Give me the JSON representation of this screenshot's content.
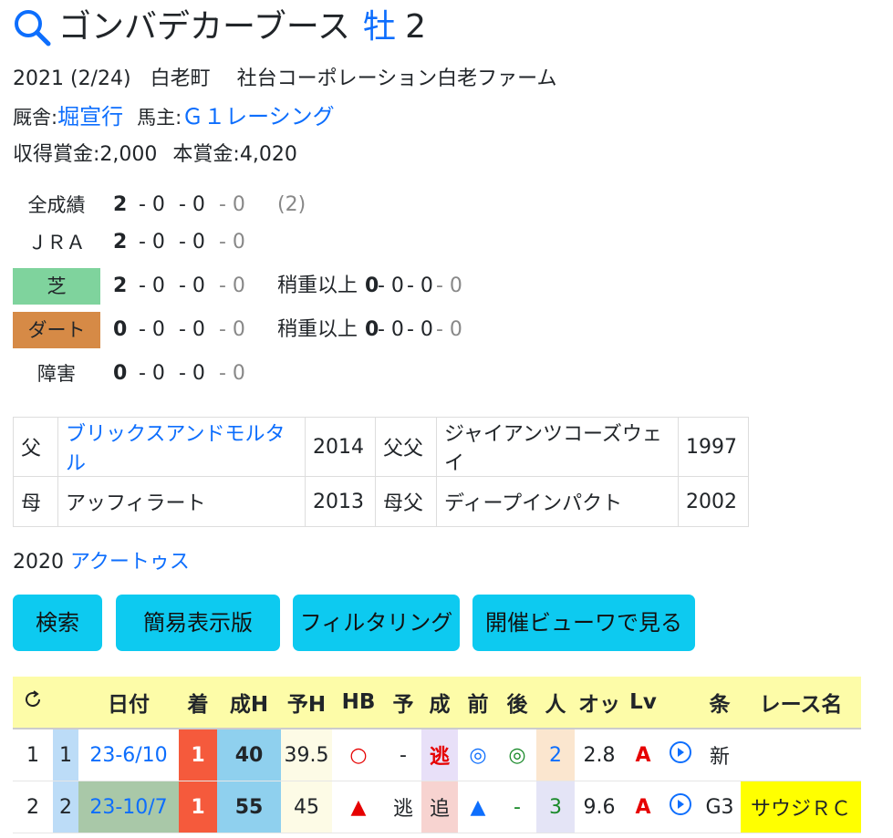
{
  "horse": {
    "name": "ゴンバデカーブース",
    "sex": "牡",
    "age": "2"
  },
  "birth": {
    "date": "2021 (2/24)",
    "place": "白老町",
    "breeder": "社台コーポレーション白老ファーム"
  },
  "stable": {
    "label": "厩舎:",
    "trainer": "堀宣行",
    "owner_label": "馬主:",
    "owner": "Ｇ１レーシング"
  },
  "prize": {
    "earned_label": "収得賞金:",
    "earned": "2,000",
    "main_label": "本賞金:",
    "main": "4,020"
  },
  "records": [
    {
      "label": "全成績",
      "n1": "2",
      "n2": "- 0",
      "n3": "- 0",
      "n4": "- 0",
      "extra": "(2)"
    },
    {
      "label": "ＪＲＡ",
      "n1": "2",
      "n2": "- 0",
      "n3": "- 0",
      "n4": "- 0",
      "extra": ""
    },
    {
      "label": "芝",
      "n1": "2",
      "n2": "- 0",
      "n3": "- 0",
      "n4": "- 0",
      "heavy_label": "稍重以上",
      "h1": "0",
      "h2": "- 0",
      "h3": "- 0",
      "h4": "- 0"
    },
    {
      "label": "ダート",
      "n1": "0",
      "n2": "- 0",
      "n3": "- 0",
      "n4": "- 0",
      "heavy_label": "稍重以上",
      "h1": "0",
      "h2": "- 0",
      "h3": "- 0",
      "h4": "- 0"
    },
    {
      "label": "障害",
      "n1": "0",
      "n2": "- 0",
      "n3": "- 0",
      "n4": "- 0"
    }
  ],
  "pedigree": [
    {
      "rel": "父",
      "name": "ブリックスアンドモルタル",
      "year": "2014",
      "rel2": "父父",
      "name2": "ジャイアンツコーズウェイ",
      "year2": "1997"
    },
    {
      "rel": "母",
      "name": "アッフィラート",
      "year": "2013",
      "rel2": "母父",
      "name2": "ディープインパクト",
      "year2": "2002"
    }
  ],
  "sibling": {
    "year": "2020",
    "name": "アクートゥス"
  },
  "buttons": [
    "検索",
    "簡易表示版",
    "フィルタリング",
    "開催ビューワで見る"
  ],
  "race_table": {
    "headers": [
      "",
      "",
      "日付",
      "着",
      "成H",
      "予H",
      "HB",
      "予",
      "成",
      "前",
      "後",
      "人",
      "オッ",
      "Lv",
      "",
      "条",
      "レース名"
    ],
    "rows": [
      {
        "no": "1",
        "n": "1",
        "date": "23-6/10",
        "place": "1",
        "seiH": "40",
        "yoH": "39.5",
        "hb": "○",
        "yo": "-",
        "sei": "逃",
        "mae": "◎",
        "ato": "◎",
        "pop": "2",
        "odds": "2.8",
        "lv": "A",
        "cond": "新",
        "race": ""
      },
      {
        "no": "2",
        "n": "2",
        "date": "23-10/7",
        "place": "1",
        "seiH": "55",
        "yoH": "45",
        "hb": "▲",
        "yo": "逃",
        "sei": "追",
        "mae": "▲",
        "ato": "-",
        "pop": "3",
        "odds": "9.6",
        "lv": "A",
        "cond": "G3",
        "race": "サウジＲＣ"
      }
    ]
  },
  "colors": {
    "link": "#0d6efd",
    "button": "#0dcaf0",
    "turf": "#7fd39d",
    "dirt": "#d68a46",
    "header": "#fdfca8",
    "place1": "#f55a3c",
    "seiH": "#8fd0ee",
    "highlight": "#ffff00"
  }
}
